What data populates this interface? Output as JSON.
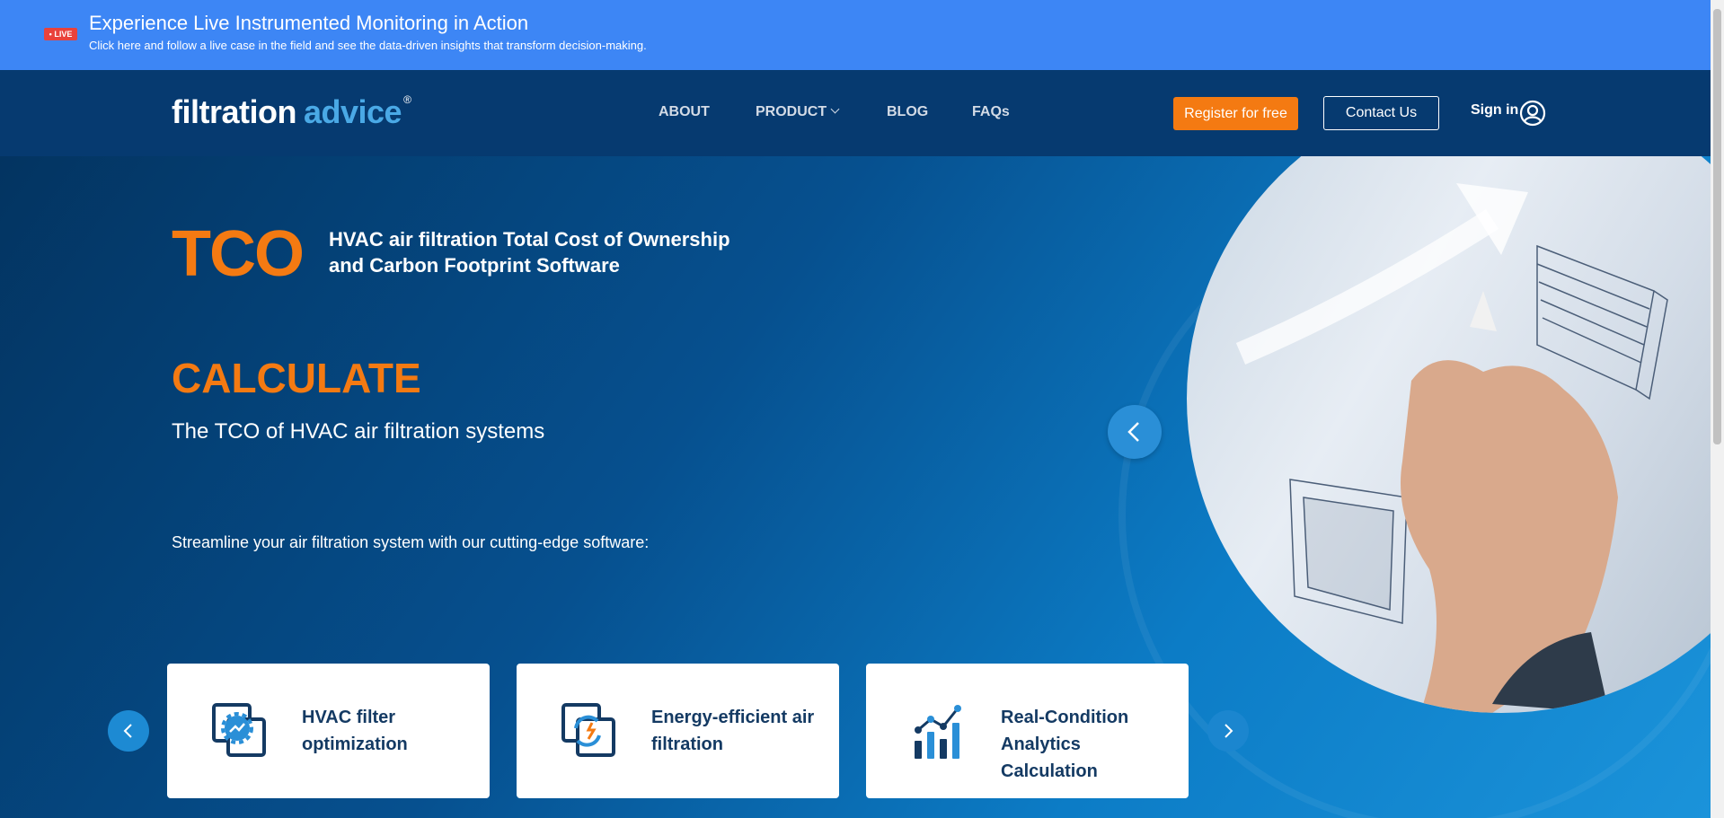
{
  "banner": {
    "live_label": "• LIVE",
    "title": "Experience Live Instrumented Monitoring in Action",
    "subtitle": "Click here and follow a live case in the field and see the data-driven insights that transform decision-making."
  },
  "header": {
    "logo_part1": "filtration",
    "logo_part2": "advice",
    "logo_mark": "®",
    "nav": [
      "ABOUT",
      "PRODUCT",
      "BLOG",
      "FAQs"
    ],
    "register_label": "Register for free",
    "contact_label": "Contact Us",
    "signin_label": "Sign in"
  },
  "hero": {
    "tco": "TCO",
    "tco_subtitle": "HVAC air filtration Total Cost of Ownership and Carbon Footprint Software",
    "headline": "CALCULATE",
    "headline_sub": "The TCO of HVAC air filtration systems",
    "tagline": "Streamline your air filtration system with our cutting-edge software:"
  },
  "cards": [
    {
      "label": "HVAC filter optimization",
      "icon": "filter-gear-icon"
    },
    {
      "label": "Energy-efficient air filtration",
      "icon": "energy-cycle-icon"
    },
    {
      "label": "Real-Condition Analytics Calculation",
      "icon": "analytics-chart-icon"
    }
  ],
  "colors": {
    "banner": "#3d86f5",
    "header": "#063a70",
    "accent_orange": "#f47a12",
    "accent_blue": "#4aa9e6",
    "card_text": "#143a63"
  }
}
